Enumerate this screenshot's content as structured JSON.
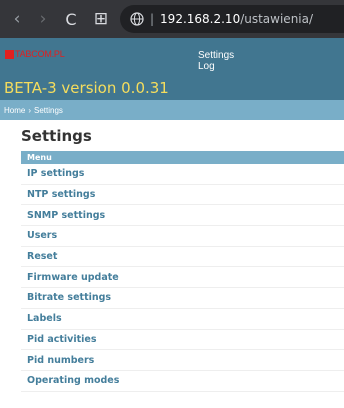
{
  "browser": {
    "back_glyph": "‹",
    "forward_glyph": "›",
    "reload_glyph": "C",
    "apps_glyph": "⊞",
    "url_host": "192.168.2.10",
    "url_path": "/ustawienia/"
  },
  "header": {
    "logo_text": "TABCOM.PL",
    "user_links": [
      "Settings",
      "Log"
    ],
    "site_title": "BETA-3 version 0.0.31",
    "colors": {
      "bar": "#417690",
      "title": "#f5dd5d",
      "logo": "#e02020"
    }
  },
  "breadcrumbs": {
    "home": "Home",
    "separator": "›",
    "current": "Settings"
  },
  "page": {
    "title": "Settings"
  },
  "menu": {
    "caption": "Menu",
    "items": [
      "IP settings",
      "NTP settings",
      "SNMP settings",
      "Users",
      "Reset",
      "Firmware update",
      "Bitrate settings",
      "Labels",
      "Pid activities",
      "Pid numbers",
      "Operating modes"
    ]
  }
}
